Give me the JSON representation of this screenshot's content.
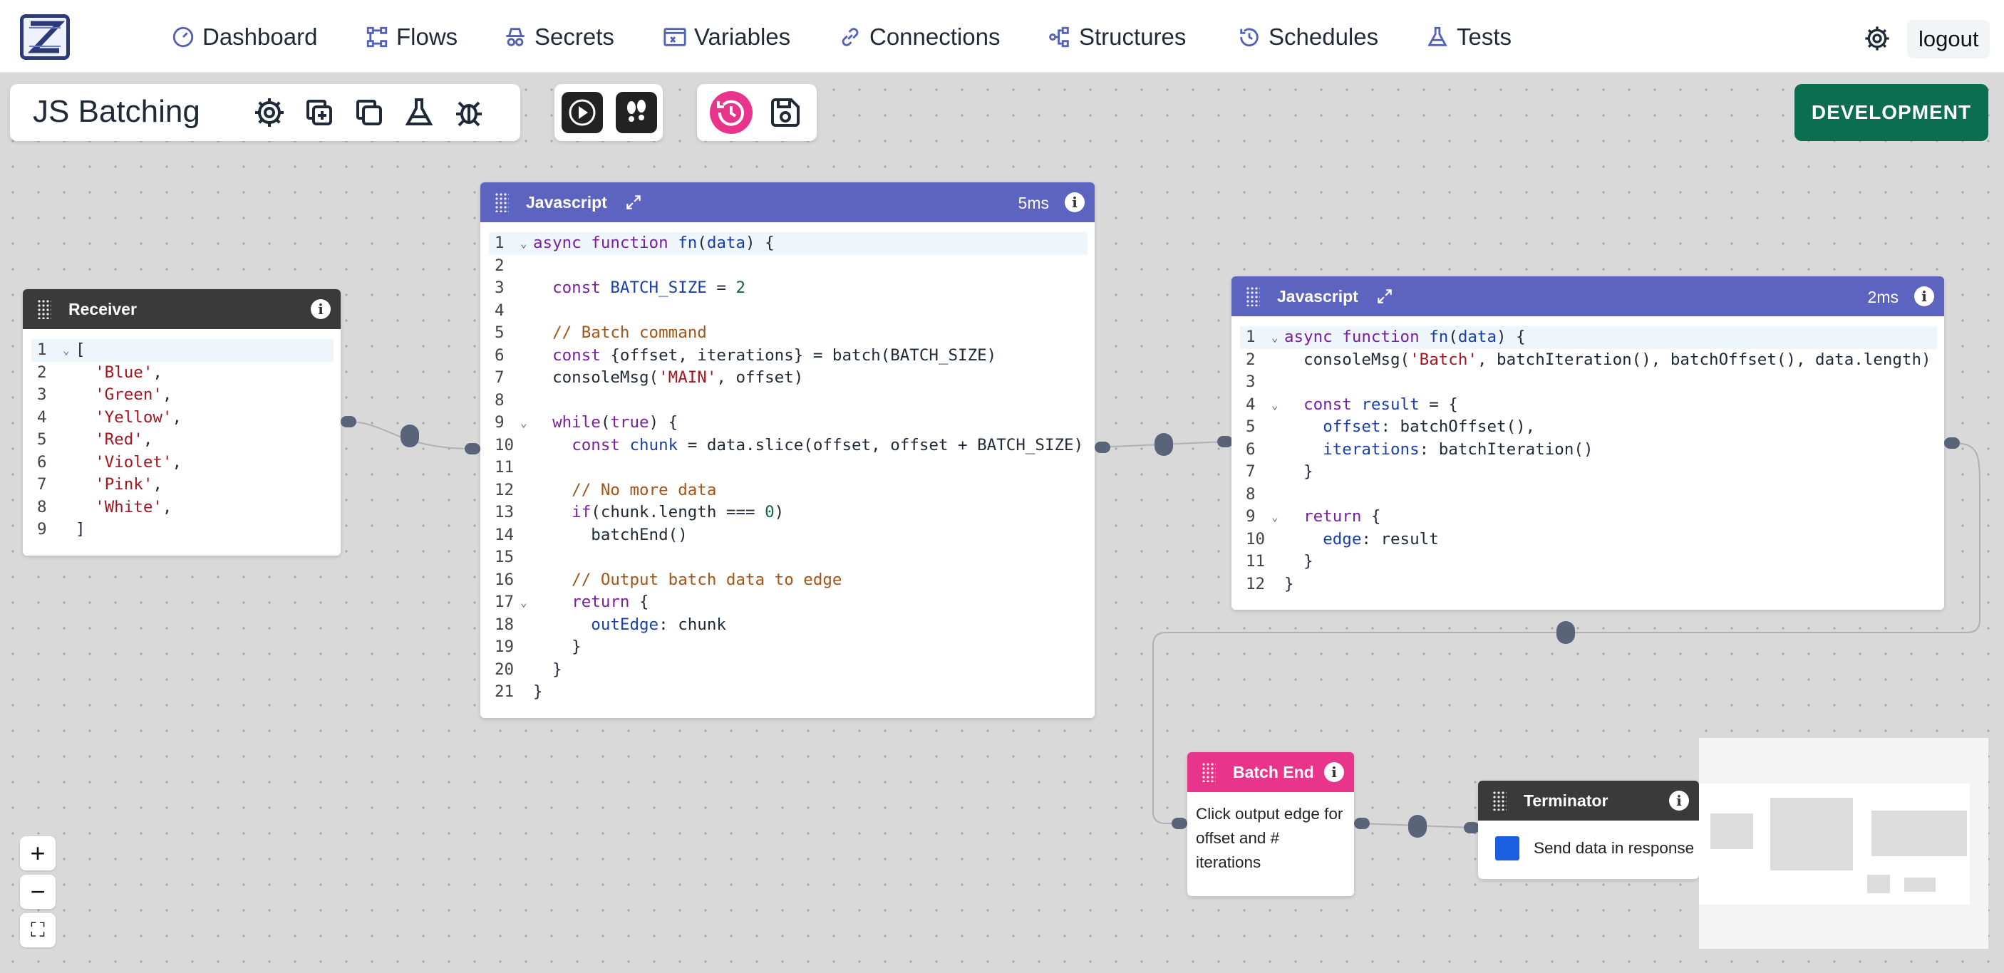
{
  "nav": {
    "items": [
      {
        "label": "Dashboard",
        "icon": "gauge-icon"
      },
      {
        "label": "Flows",
        "icon": "flow-icon"
      },
      {
        "label": "Secrets",
        "icon": "spy-icon"
      },
      {
        "label": "Variables",
        "icon": "variable-icon"
      },
      {
        "label": "Connections",
        "icon": "link-icon"
      },
      {
        "label": "Structures",
        "icon": "structure-icon"
      },
      {
        "label": "Schedules",
        "icon": "history-icon"
      },
      {
        "label": "Tests",
        "icon": "flask-icon"
      }
    ],
    "logout_label": "logout"
  },
  "flow": {
    "title": "JS Batching",
    "environment": "DEVELOPMENT",
    "environment_color": "#0b6e4f"
  },
  "nodes": {
    "receiver": {
      "title": "Receiver",
      "header_color": "#3a3a3a",
      "lines": [
        "[",
        "  'Blue',",
        "  'Green',",
        "  'Yellow',",
        "  'Red',",
        "  'Violet',",
        "  'Pink',",
        "  'White',",
        "]"
      ]
    },
    "js_main": {
      "title": "Javascript",
      "timing": "5ms",
      "header_color": "#5c64bf"
    },
    "js_batch": {
      "title": "Javascript",
      "timing": "2ms",
      "header_color": "#5c64bf"
    },
    "batch_end": {
      "title": "Batch End",
      "header_color": "#e8348a",
      "description": "Click output edge for offset and # iterations"
    },
    "terminator": {
      "title": "Terminator",
      "header_color": "#3a3a3a",
      "option_label": "Send data in response",
      "checkbox_color": "#1a5fe0"
    }
  },
  "zoom": {
    "in": "+",
    "out": "−",
    "fit": "⛶"
  }
}
